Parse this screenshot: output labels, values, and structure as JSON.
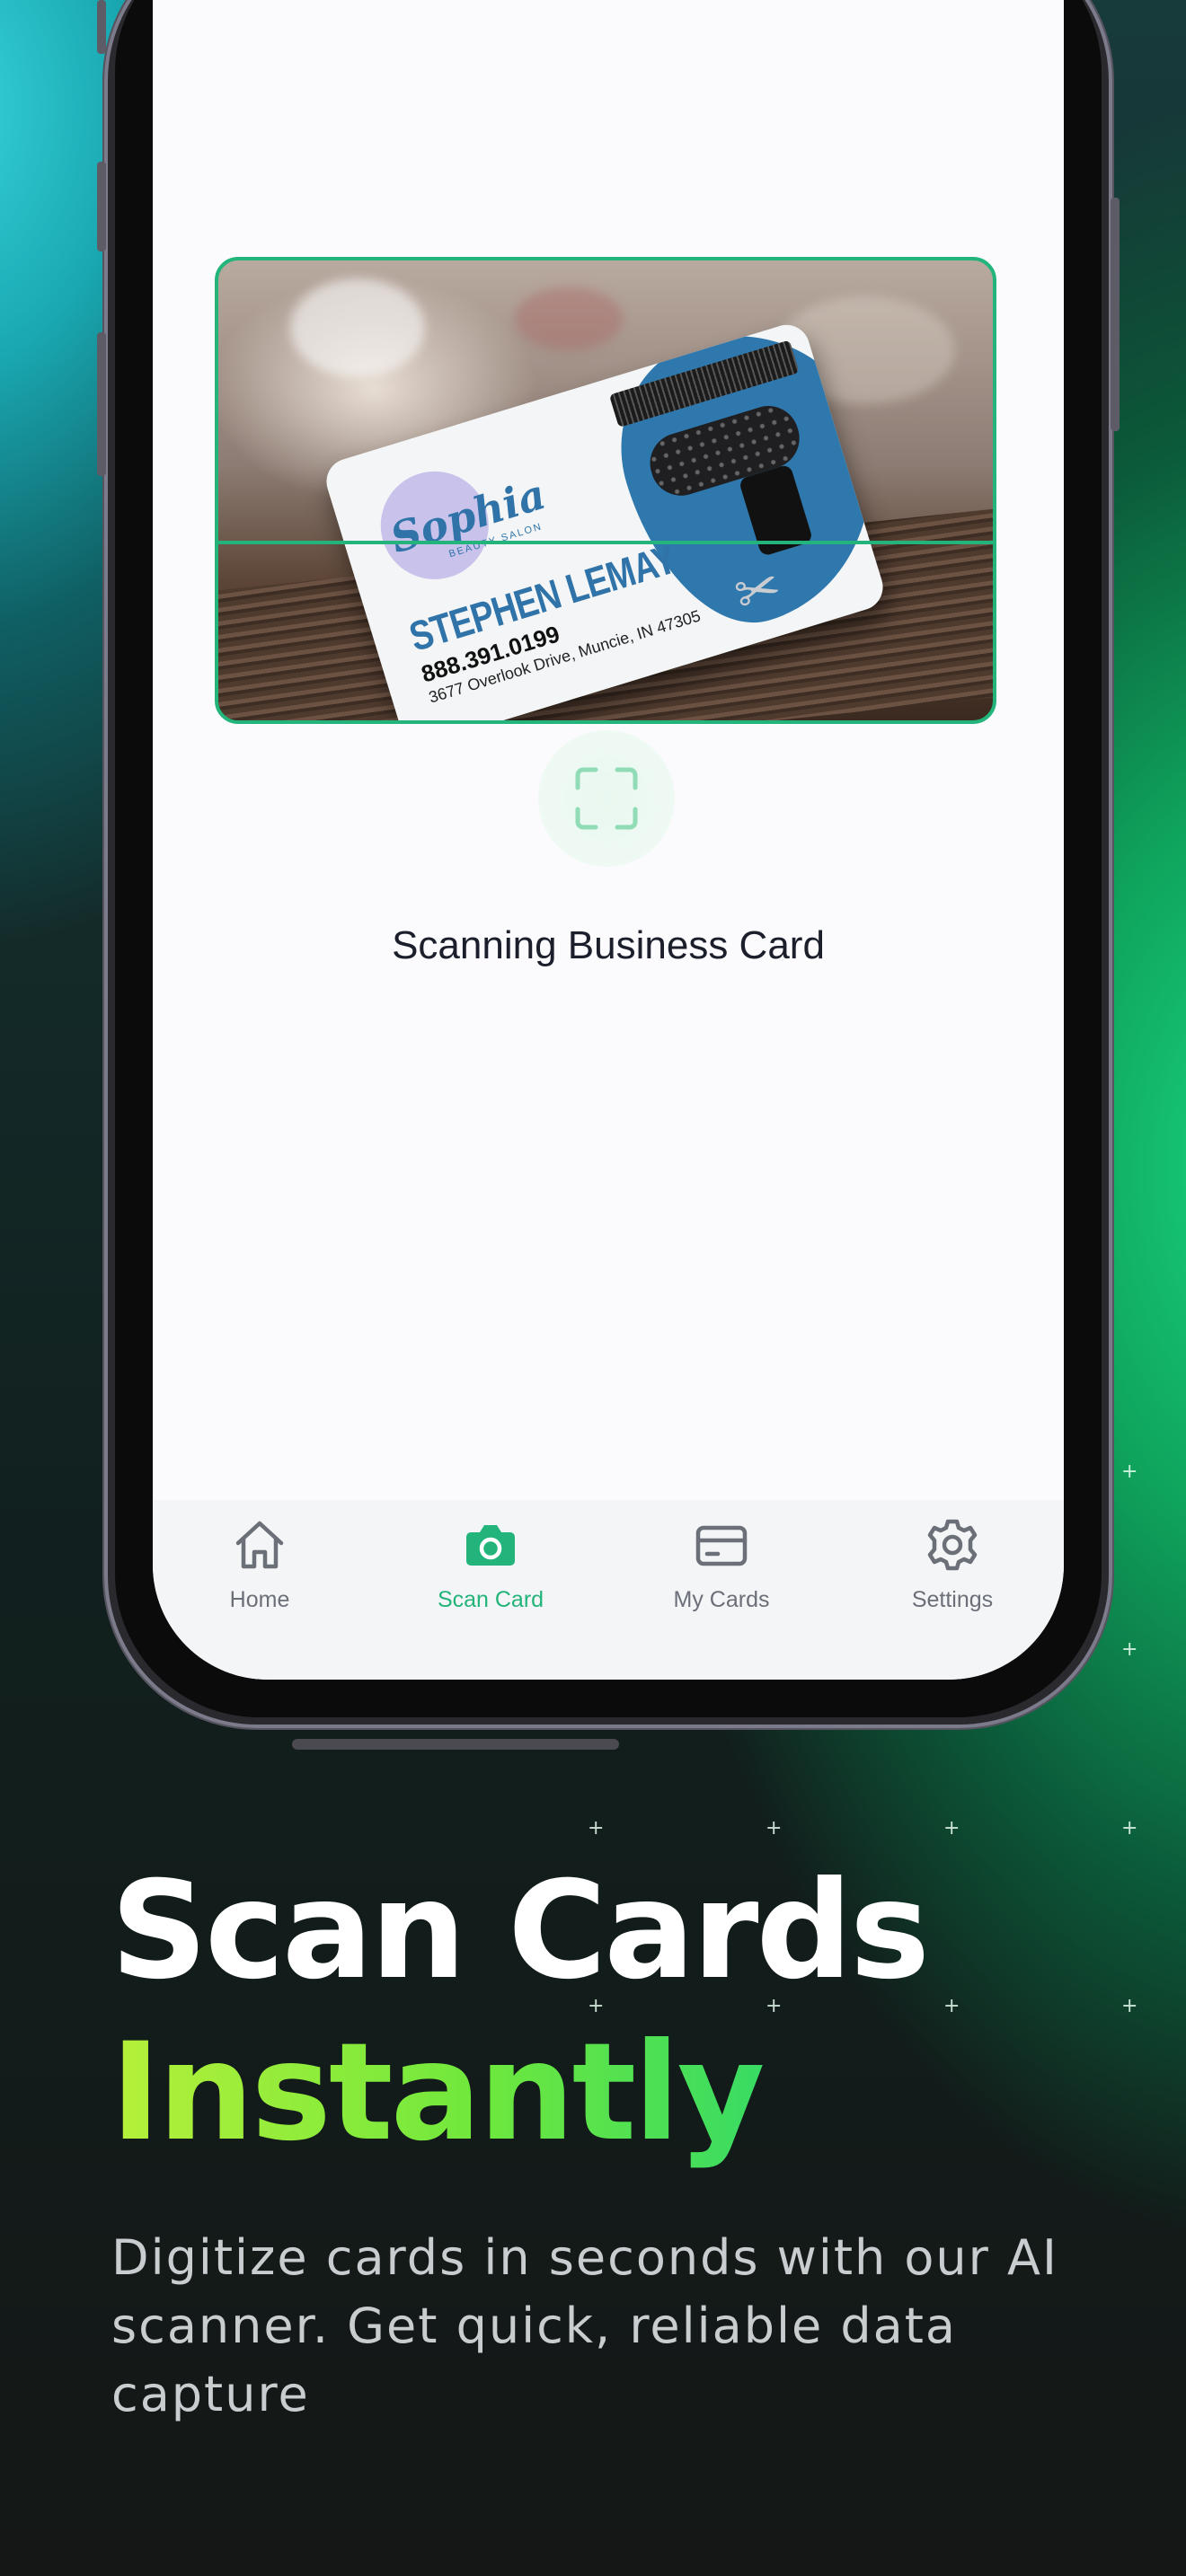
{
  "screen": {
    "scan_status": "Scanning Business Card",
    "scan_icon": "scan-frame-icon",
    "business_card": {
      "brand": "Sophia",
      "brand_sub": "BEAUTY SALON",
      "name": "STEPHEN LEMAY",
      "phone": "888.391.0199",
      "address": "3677 Overlook Drive, Muncie, IN 47305"
    }
  },
  "tabbar": {
    "active": "Scan Card",
    "items": [
      {
        "label": "Home",
        "icon": "home-icon"
      },
      {
        "label": "Scan Card",
        "icon": "camera-icon"
      },
      {
        "label": "My Cards",
        "icon": "card-icon"
      },
      {
        "label": "Settings",
        "icon": "gear-icon"
      }
    ]
  },
  "marketing": {
    "headline_line1": "Scan Cards",
    "headline_line2": "Instantly",
    "subcopy": "Digitize cards in seconds with our AI scanner. Get quick, reliable data capture"
  },
  "colors": {
    "accent": "#22b47a",
    "headline_gradient_start": "#b6f03a",
    "headline_gradient_end": "#19d37a"
  }
}
